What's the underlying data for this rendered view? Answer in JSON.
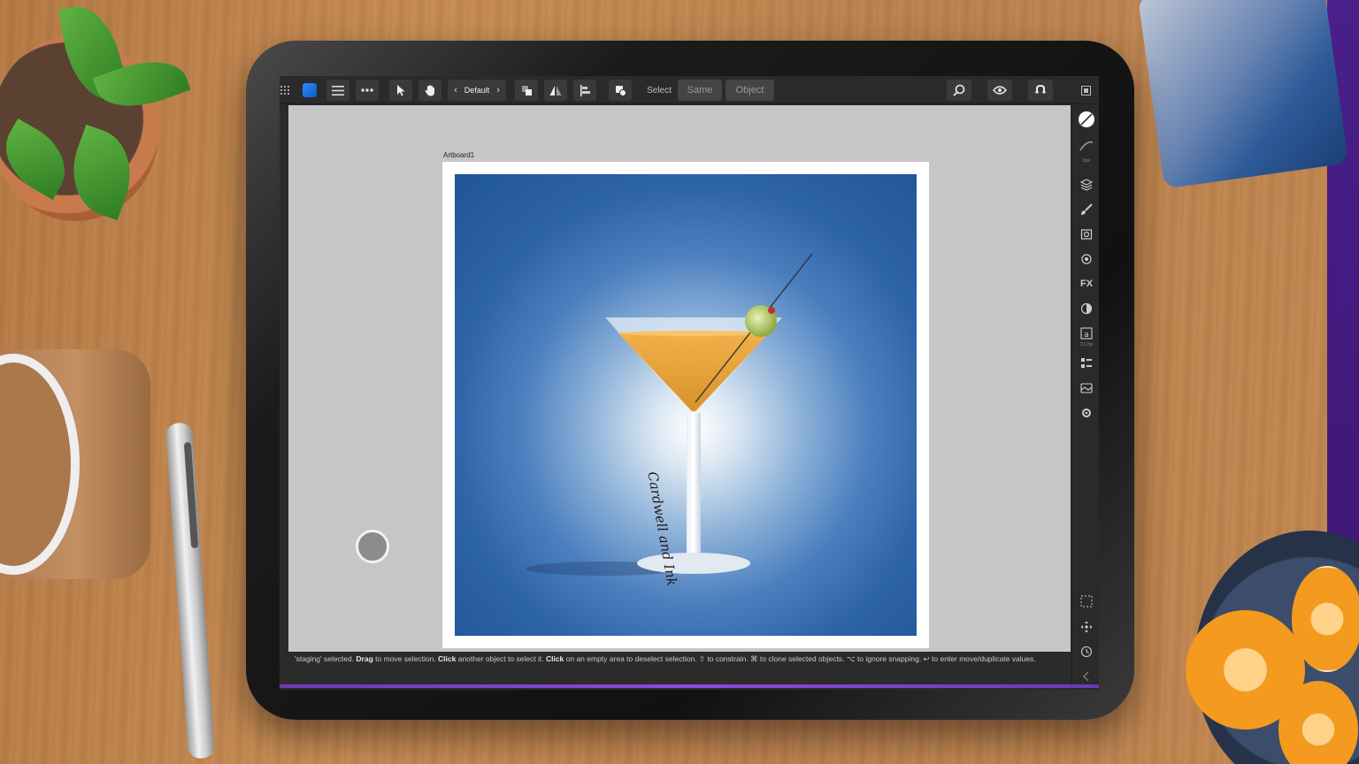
{
  "toolbar": {
    "persona_label": "Default",
    "select_label": "Select",
    "same_label": "Same",
    "object_label": "Object"
  },
  "icons": {
    "grid": "grid-icon",
    "app": "designer-logo-icon",
    "menu": "hamburger-menu-icon",
    "more": "more-dots-icon",
    "move": "move-tool-icon",
    "hand": "hand-tool-icon",
    "prev": "chevron-left-icon",
    "next": "chevron-right-icon",
    "arrange": "arrange-icon",
    "flip": "flip-icon",
    "align": "align-icon",
    "boolean": "boolean-icon",
    "zoom": "zoom-icon",
    "view": "view-mode-icon",
    "snapping": "snapping-icon",
    "fullscreen": "fullscreen-icon"
  },
  "canvas": {
    "artboard_name": "Artboard1",
    "signature_text": "Cardwell and Ink"
  },
  "right_panel": {
    "stroke_width": "0px",
    "text_size": "21.2pt"
  },
  "status": {
    "selected_prefix": "'staging' selected.",
    "drag": "Drag",
    "drag_text": " to move selection. ",
    "click": "Click",
    "click_text": " another object to select it. ",
    "click2": "Click",
    "click2_text": " on an empty area to deselect selection. ⇧ to constrain. ⌘ to clone selected objects. ⌥ to ignore snapping. ↩ to enter move/duplicate values."
  },
  "colors": {
    "accent": "#2b8cff",
    "ui_dark": "#2a2a2a",
    "canvas_gray": "#c6c6c6",
    "bottom_accent": "#8a4be0"
  }
}
